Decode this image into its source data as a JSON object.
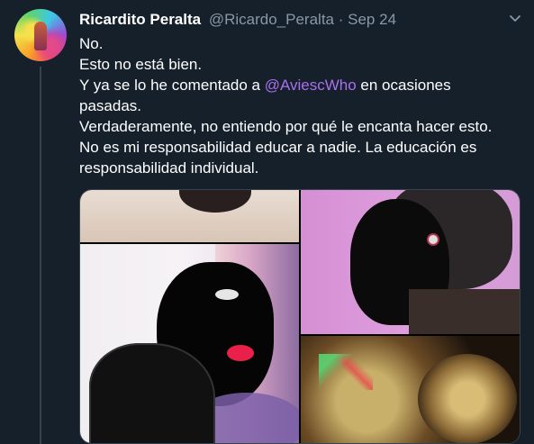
{
  "tweet": {
    "author_name": "Ricardito Peralta",
    "handle": "@Ricardo_Peralta",
    "separator": "·",
    "date": "Sep 24",
    "text_lines": [
      {
        "text": "No."
      },
      {
        "text": "Esto no está bien."
      },
      {
        "prefix": "Y ya se lo he comentado a ",
        "mention": "@AviescWho",
        "suffix": " en ocasiones"
      },
      {
        "text": "pasadas."
      },
      {
        "text": "Verdaderamente, no entiendo por qué le encanta hacer esto."
      },
      {
        "text": "No es mi responsabilidad educar a nadie. La educación es"
      },
      {
        "text": "responsabilidad individual."
      }
    ]
  },
  "icons": {
    "more": "chevron-down-icon"
  },
  "colors": {
    "background": "#15202b",
    "secondary_text": "#8899a6",
    "mention": "#a96ff0",
    "border": "#38444d"
  }
}
